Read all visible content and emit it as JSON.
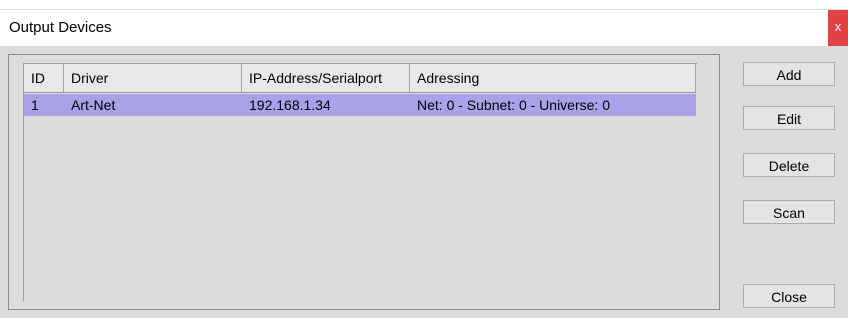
{
  "window": {
    "title": "Output Devices",
    "close_glyph": "x"
  },
  "table": {
    "columns": [
      "ID",
      "Driver",
      "IP-Address/Serialport",
      "Adressing"
    ],
    "rows": [
      {
        "id": "1",
        "driver": "Art-Net",
        "address": "192.168.1.34",
        "addressing": "Net: 0 - Subnet: 0 - Universe: 0",
        "selected": true
      }
    ],
    "selected_color": "#a9a2e8"
  },
  "buttons": {
    "add": "Add",
    "edit": "Edit",
    "delete": "Delete",
    "scan": "Scan",
    "close": "Close"
  },
  "colors": {
    "background": "#dcdcdc",
    "close_accent": "#e04343"
  }
}
